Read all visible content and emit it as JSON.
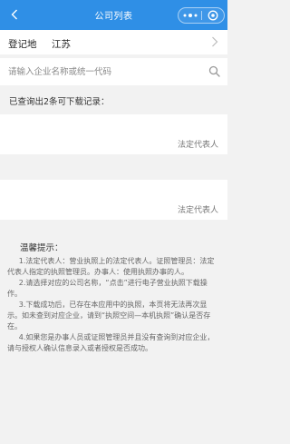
{
  "navbar": {
    "title": "公司列表",
    "back_icon": "chevron-left-icon",
    "bg_color": "#2f8fe6"
  },
  "registration": {
    "label": "登记地",
    "value": "江苏"
  },
  "search": {
    "placeholder": "请输入企业名称或统一代码",
    "value": ""
  },
  "results": {
    "summary": "已查询出2条可下载记录：",
    "records": [
      {
        "role_label": "法定代表人"
      },
      {
        "role_label": "法定代表人"
      }
    ]
  },
  "notice": {
    "title": "温馨提示：",
    "items": [
      "1.法定代表人：营业执照上的法定代表人。证照管理员：法定代表人指定的执照管理员。办事人：使用执照办事的人。",
      "2.请选择对应的公司名称，“点击”进行电子营业执照下载操作。",
      "3.下载成功后，已存在本应用中的执照，本页将无法再次显示。如未查到对应企业，请到“执照空间—本机执照”确认是否存在。",
      "4.如果您是办事人员或证照管理员并且没有查询到对应企业，请与授权人确认信息录入或者授权是否成功。"
    ]
  }
}
